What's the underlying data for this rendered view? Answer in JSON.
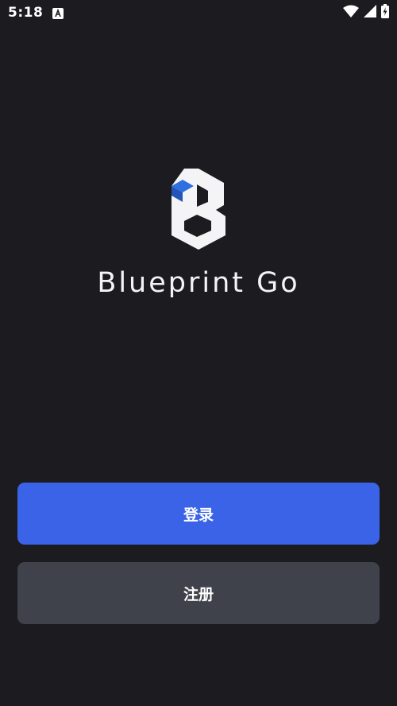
{
  "status_bar": {
    "time": "5:18",
    "icons": [
      "notification-a-icon",
      "wifi-icon",
      "cellular-signal-icon",
      "battery-charging-icon"
    ]
  },
  "branding": {
    "app_name": "Blueprint Go",
    "logo": "blueprint-go-logo"
  },
  "actions": {
    "login_label": "登录",
    "register_label": "注册"
  },
  "colors": {
    "background": "#1b1b20",
    "primary": "#3a63e8",
    "secondary": "#40424b",
    "logo_accent": "#2f6fe0"
  }
}
